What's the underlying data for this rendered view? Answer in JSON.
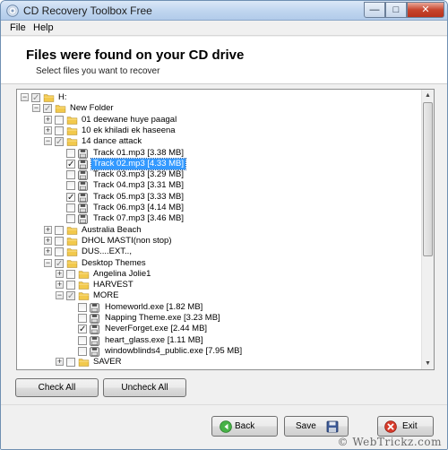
{
  "window": {
    "title": "CD Recovery Toolbox Free"
  },
  "menu": {
    "file": "File",
    "help": "Help"
  },
  "header": {
    "title": "Files were found on your CD drive",
    "subtitle": "Select files you want to recover"
  },
  "tree": {
    "rows": [
      {
        "label": "H:",
        "level": 0,
        "type": "folder",
        "expanded": true,
        "check": "grey"
      },
      {
        "label": "New Folder",
        "level": 1,
        "type": "folder",
        "expanded": true,
        "check": "grey"
      },
      {
        "label": "01  deewane huye paagal",
        "level": 2,
        "type": "folder",
        "expanded": false,
        "check": "none"
      },
      {
        "label": "10 ek khiladi ek haseena",
        "level": 2,
        "type": "folder",
        "expanded": false,
        "check": "none"
      },
      {
        "label": "14  dance attack",
        "level": 2,
        "type": "folder",
        "expanded": true,
        "check": "grey"
      },
      {
        "label": "Track 01.mp3   [3.38 MB]",
        "level": 3,
        "type": "file",
        "check": "none"
      },
      {
        "label": "Track 02.mp3   [4.33 MB]",
        "level": 3,
        "type": "file",
        "check": "checked",
        "selected": true
      },
      {
        "label": "Track 03.mp3   [3.29 MB]",
        "level": 3,
        "type": "file",
        "check": "none"
      },
      {
        "label": "Track 04.mp3   [3.31 MB]",
        "level": 3,
        "type": "file",
        "check": "none"
      },
      {
        "label": "Track 05.mp3   [3.33 MB]",
        "level": 3,
        "type": "file",
        "check": "checked"
      },
      {
        "label": "Track 06.mp3   [4.14 MB]",
        "level": 3,
        "type": "file",
        "check": "none"
      },
      {
        "label": "Track 07.mp3   [3.46 MB]",
        "level": 3,
        "type": "file",
        "check": "none"
      },
      {
        "label": "Australia Beach",
        "level": 2,
        "type": "folder",
        "expanded": false,
        "check": "none"
      },
      {
        "label": "DHOL MASTI(non stop)",
        "level": 2,
        "type": "folder",
        "expanded": false,
        "check": "none"
      },
      {
        "label": "DUS....EXT..,",
        "level": 2,
        "type": "folder",
        "expanded": false,
        "check": "none"
      },
      {
        "label": "Desktop Themes",
        "level": 2,
        "type": "folder",
        "expanded": true,
        "check": "grey"
      },
      {
        "label": "Angelina Jolie1",
        "level": 3,
        "type": "folder",
        "expanded": false,
        "check": "none"
      },
      {
        "label": "HARVEST",
        "level": 3,
        "type": "folder",
        "expanded": false,
        "check": "none"
      },
      {
        "label": "MORE",
        "level": 3,
        "type": "folder",
        "expanded": true,
        "check": "grey"
      },
      {
        "label": "Homeworld.exe   [1.82 MB]",
        "level": 4,
        "type": "file",
        "check": "none"
      },
      {
        "label": "Napping Theme.exe   [3.23 MB]",
        "level": 4,
        "type": "file",
        "check": "none"
      },
      {
        "label": "NeverForget.exe   [2.44 MB]",
        "level": 4,
        "type": "file",
        "check": "checked"
      },
      {
        "label": "heart_glass.exe   [1.11 MB]",
        "level": 4,
        "type": "file",
        "check": "none"
      },
      {
        "label": "windowblinds4_public.exe   [7.95 MB]",
        "level": 4,
        "type": "file",
        "check": "none"
      },
      {
        "label": "SAVER",
        "level": 3,
        "type": "folder",
        "expanded": false,
        "check": "none"
      }
    ]
  },
  "buttons": {
    "check_all": "Check All",
    "uncheck_all": "Uncheck All",
    "back": "Back",
    "save": "Save",
    "exit": "Exit"
  },
  "watermark": "© WebTrickz.com",
  "colors": {
    "selection": "#3399ff",
    "folder": "#f2c94c",
    "exit_icon": "#d83a2a",
    "back_icon": "#3ca53c"
  }
}
